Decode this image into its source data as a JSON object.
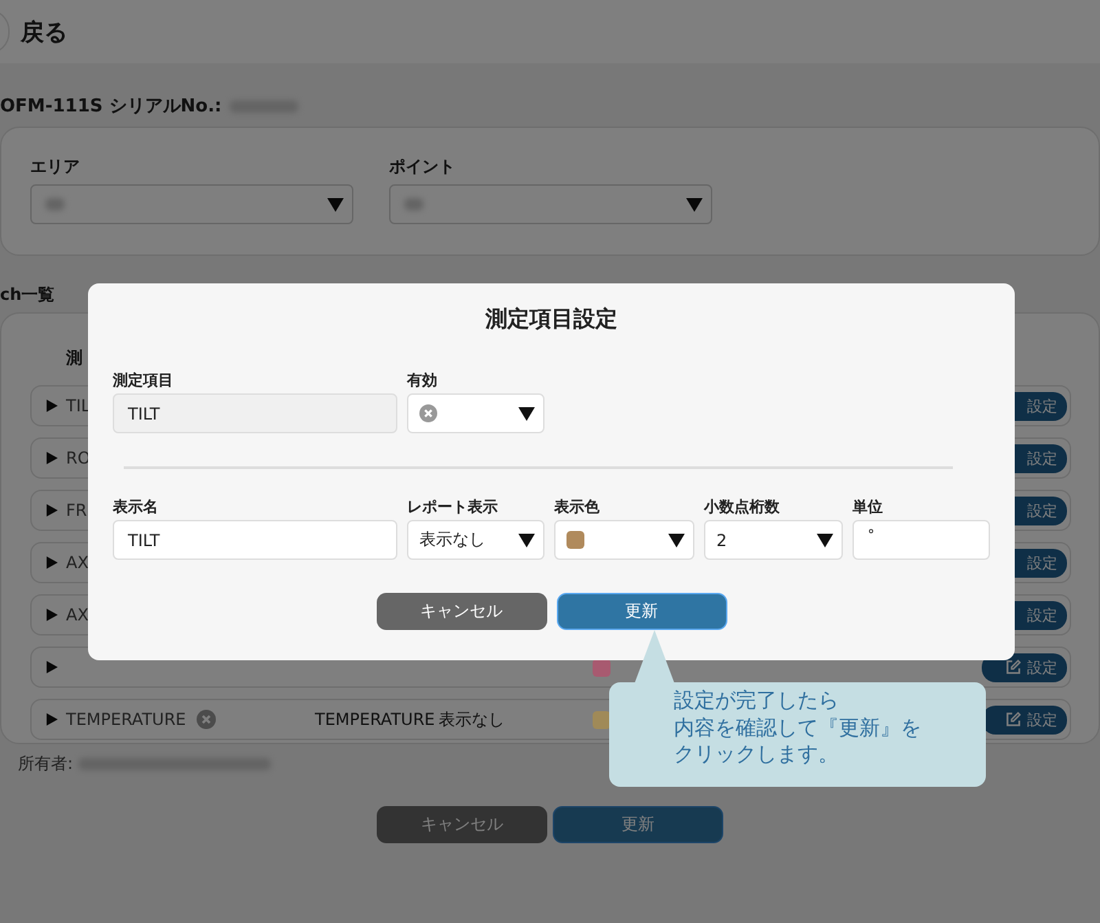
{
  "header": {
    "back_label": "戻る"
  },
  "device": {
    "label": "OFM-111S シリアルNo.:"
  },
  "filters": [
    {
      "label": "エリア"
    },
    {
      "label": "ポイント"
    }
  ],
  "channel_list": {
    "title": "ch一覧",
    "column_1": "測",
    "rows": [
      {
        "name": "TIL",
        "settings": "設定"
      },
      {
        "name": "RO",
        "settings": "設定"
      },
      {
        "name": "FR",
        "settings": "設定"
      },
      {
        "name": "AX",
        "settings": "設定"
      },
      {
        "name": "AX",
        "settings": "設定"
      },
      {
        "color": "#a85a70",
        "settings": "設定"
      },
      {
        "name": "TEMPERATURE",
        "enabled": false,
        "display_name": "TEMPERATURE",
        "report": "表示なし",
        "color": "#a08a58",
        "settings": "設定"
      }
    ]
  },
  "owner": {
    "label": "所有者:"
  },
  "page_buttons": {
    "cancel": "キャンセル",
    "update": "更新"
  },
  "dialog": {
    "title": "測定項目設定",
    "item": {
      "label": "測定項目",
      "value": "TILT"
    },
    "enabled": {
      "label": "有効",
      "value": false
    },
    "display_name": {
      "label": "表示名",
      "value": "TILT"
    },
    "report": {
      "label": "レポート表示",
      "value": "表示なし"
    },
    "color": {
      "label": "表示色",
      "color": "#b08a5c"
    },
    "decimals": {
      "label": "小数点桁数",
      "value": "2"
    },
    "unit": {
      "label": "単位",
      "value": "°"
    },
    "cancel": "キャンセル",
    "update": "更新"
  },
  "tooltip": {
    "lines": [
      "設定が完了したら",
      "内容を確認して『更新』を",
      "クリックします。"
    ]
  }
}
